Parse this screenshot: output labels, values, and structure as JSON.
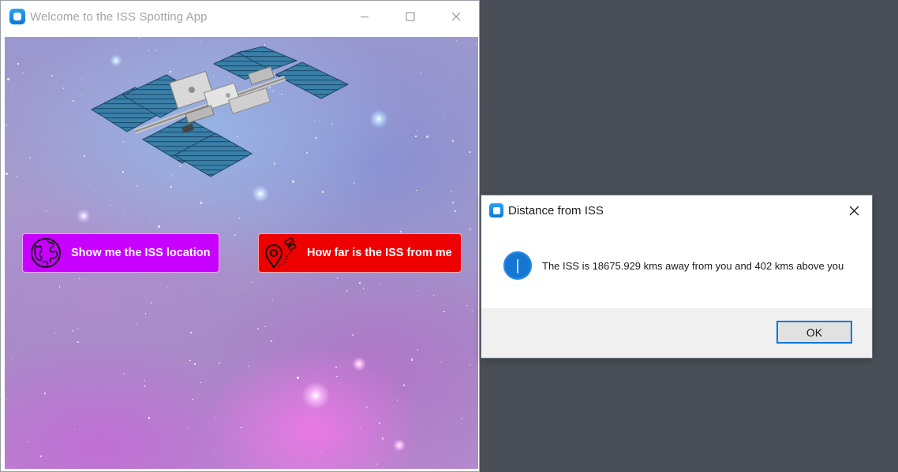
{
  "main_window": {
    "title": "Welcome to the ISS Spotting App",
    "controls": {
      "minimize": "minimize-icon",
      "maximize": "maximize-icon",
      "close": "close-icon"
    },
    "buttons": {
      "location": {
        "label": "Show me the ISS location",
        "icon": "globe-icon",
        "color": "#c800ff"
      },
      "distance": {
        "label": "How far is the ISS from me",
        "icon": "map-pin-icon",
        "color": "#ee0000"
      }
    }
  },
  "dialog": {
    "title": "Distance from ISS",
    "message": "The ISS is 18675.929 kms away from you and 402 kms above you",
    "icon": "info-icon",
    "ok_label": "OK",
    "accent": "#0078d7"
  },
  "colors": {
    "desktop": "#4a4f57",
    "app_icon": "#0b77d8"
  }
}
